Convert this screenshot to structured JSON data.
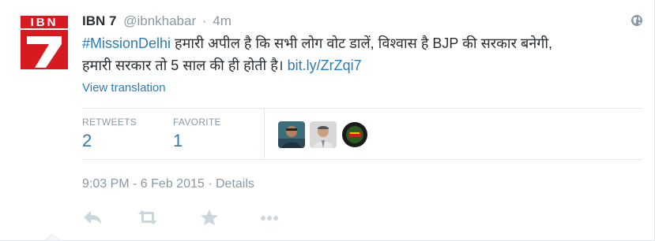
{
  "tweet": {
    "display_name": "IBN 7",
    "handle": "@ibnkhabar",
    "separator": "·",
    "relative_time": "4m",
    "hashtag": "#MissionDelhi",
    "text_part1": " हमारी अपील है कि सभी लोग वोट डालें, विश्वास है BJP की सरकार बनेगी,",
    "text_part2": "हमारी सरकार तो 5 साल की ही होती है। ",
    "link": "bit.ly/ZrZqi7",
    "view_translation": "View translation"
  },
  "stats": {
    "retweets_label": "RETWEETS",
    "retweets_count": "2",
    "favorite_label": "FAVORITE",
    "favorite_count": "1"
  },
  "timestamp": {
    "datetime": "9:03 PM - 6 Feb 2015",
    "separator": "·",
    "details": "Details"
  },
  "avatar_logo_text": "IBN",
  "icons": {
    "globe": "globe-icon",
    "reply": "reply-icon",
    "retweet": "retweet-icon",
    "favorite": "star-icon",
    "more": "more-icon"
  },
  "colors": {
    "link": "#2b7bb9",
    "muted": "#8899a6",
    "text": "#292f33",
    "logo_red": "#d71920"
  }
}
